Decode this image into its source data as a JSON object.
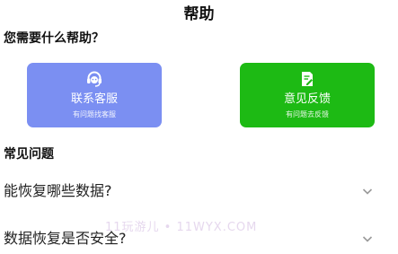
{
  "header": {
    "title": "帮助"
  },
  "help_section": {
    "heading": "您需要什么帮助？"
  },
  "cards": {
    "service": {
      "title": "联系客服",
      "subtitle": "有问题找客服",
      "icon": "headset-icon",
      "color": "#7b8ff2"
    },
    "feedback": {
      "title": "意见反馈",
      "subtitle": "有问题去反馈",
      "icon": "feedback-edit-icon",
      "color": "#1dba14"
    }
  },
  "faq": {
    "heading": "常见问题",
    "items": [
      {
        "question": "能恢复哪些数据?",
        "icon": "chevron-down-icon"
      },
      {
        "question": "数据恢复是否安全?",
        "icon": "chevron-down-icon"
      }
    ]
  },
  "watermark": {
    "text": "11玩游儿 • 11WYX.COM"
  }
}
